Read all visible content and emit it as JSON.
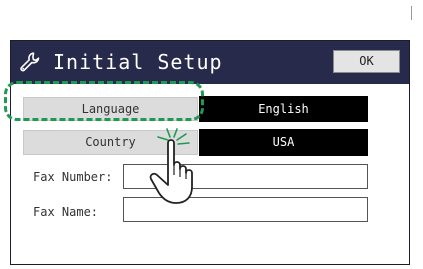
{
  "title": "Initial Setup",
  "icons": {
    "title": "wrench-icon",
    "pointer": "pointing-hand-icon"
  },
  "ok_button": {
    "label": "OK"
  },
  "rows": {
    "language": {
      "label": "Language",
      "value": "English"
    },
    "country": {
      "label": "Country",
      "value": "USA"
    }
  },
  "fields": {
    "fax_number": {
      "label": "Fax Number:",
      "value": ""
    },
    "fax_name": {
      "label": "Fax Name:",
      "value": ""
    }
  },
  "colors": {
    "title_bar": "#272a4a",
    "highlight": "#1f9a51",
    "value_box": "#000000",
    "label_button": "#dcdcdc"
  }
}
